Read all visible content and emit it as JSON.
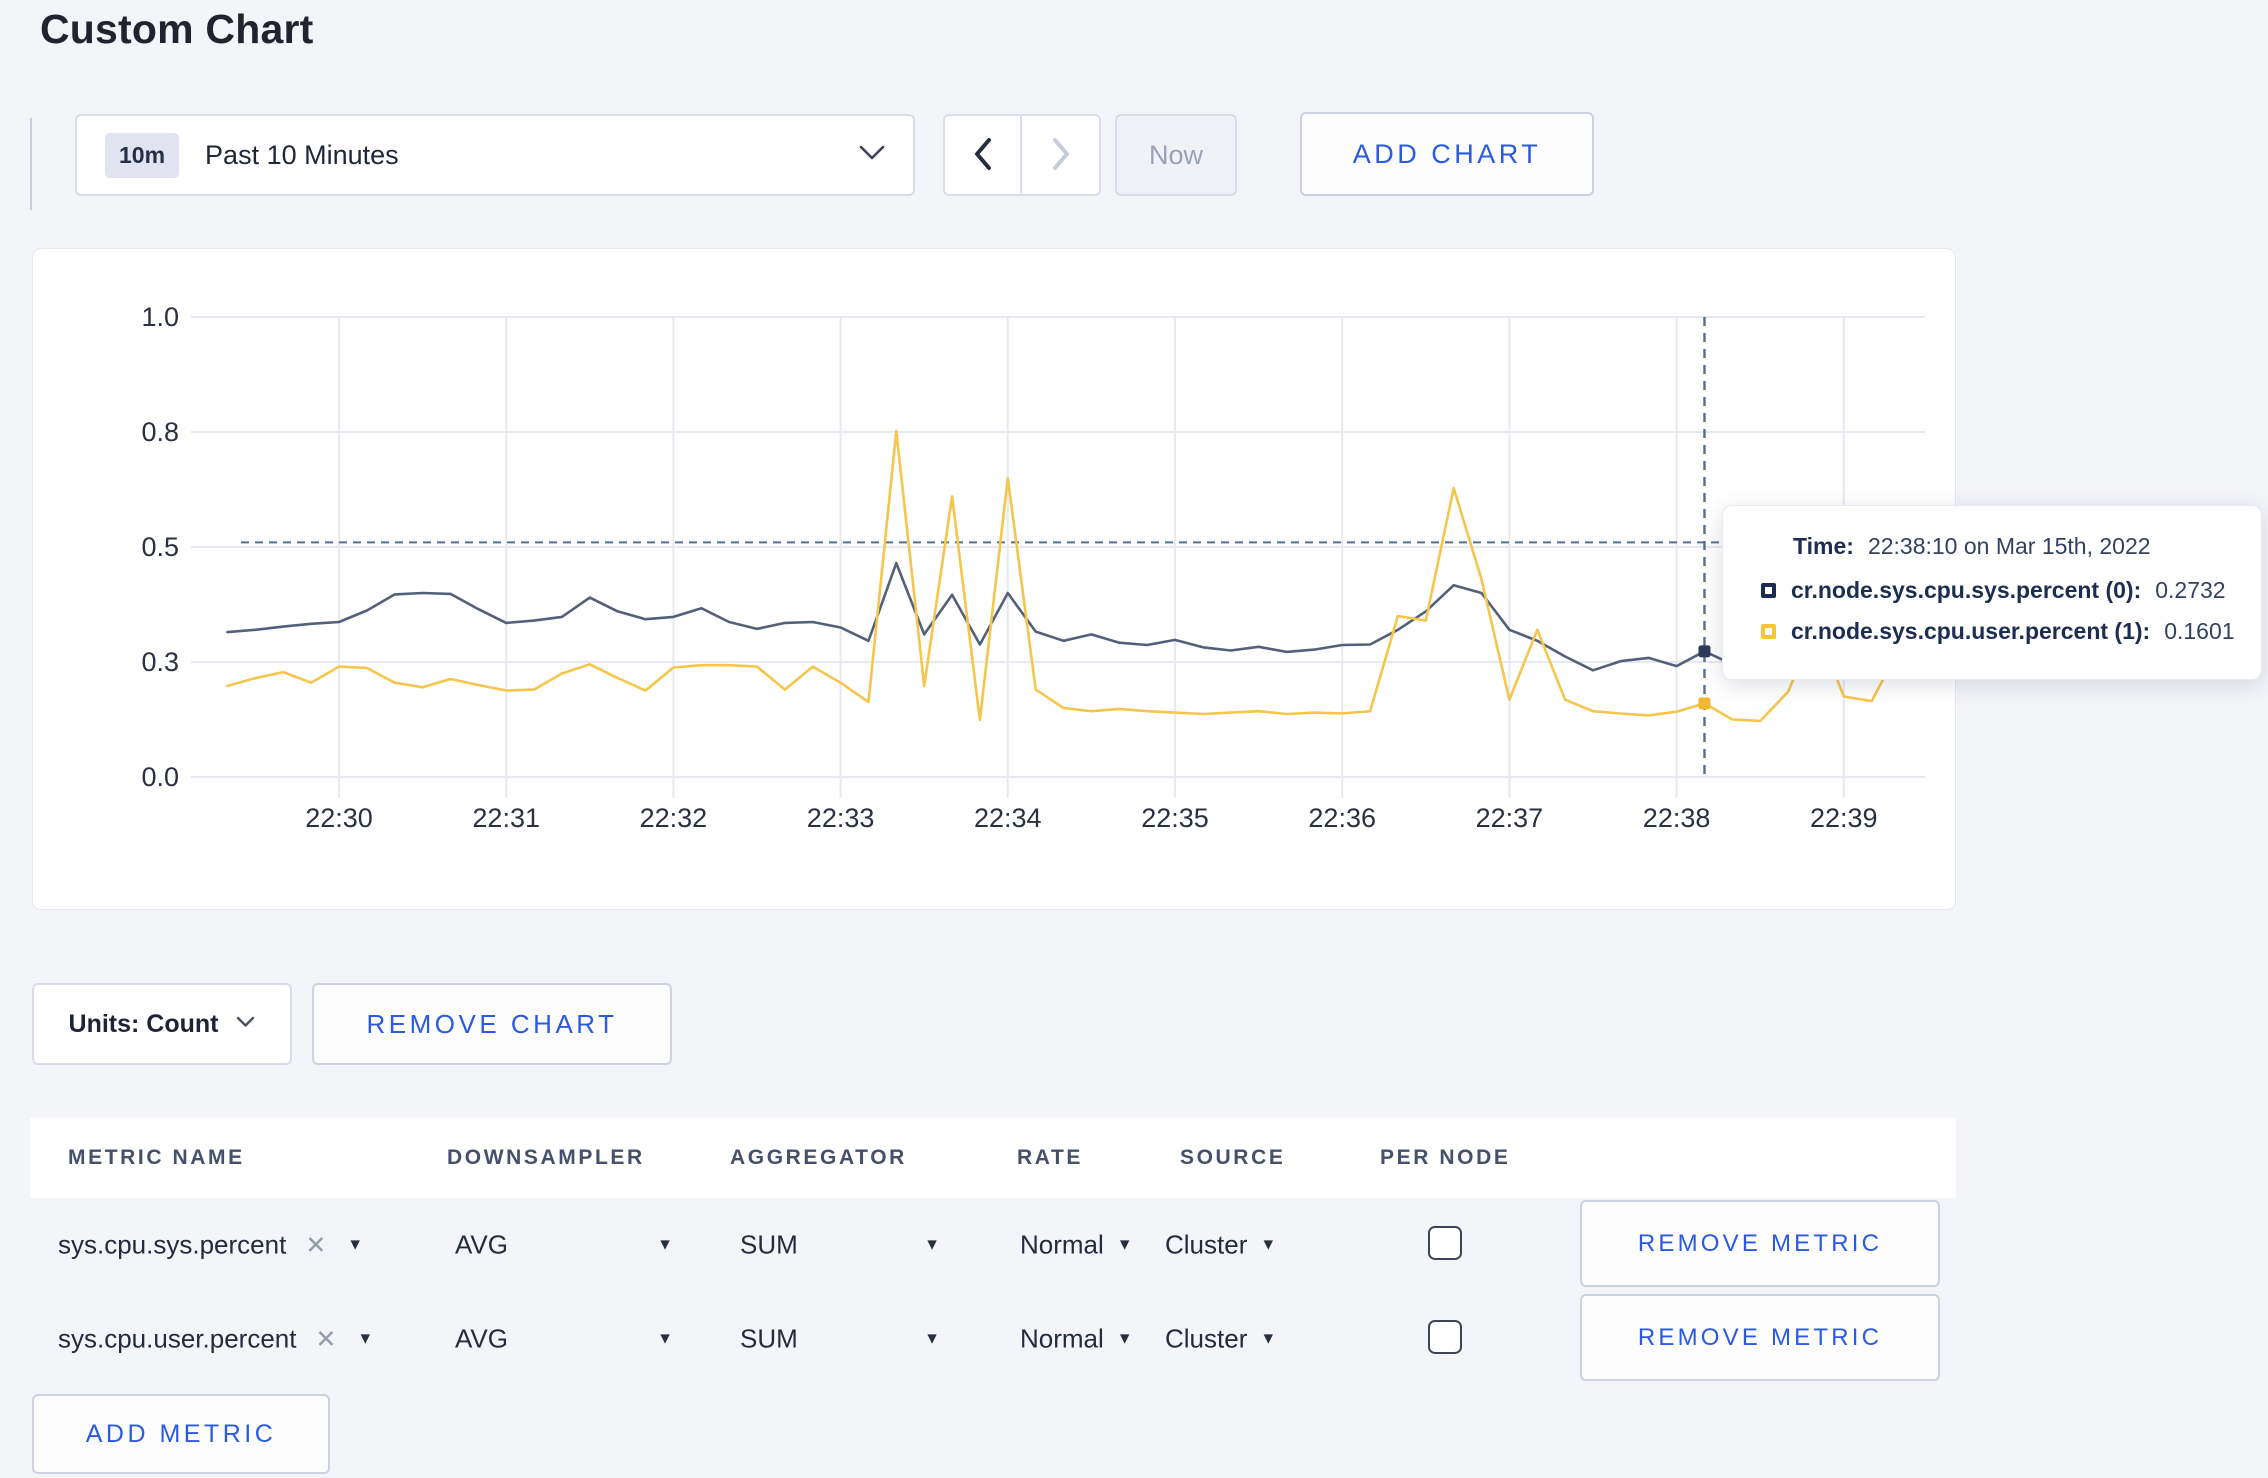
{
  "title": "Custom Chart",
  "toolbar": {
    "range_badge": "10m",
    "range_label": "Past 10 Minutes",
    "now_label": "Now",
    "add_chart_label": "ADD CHART"
  },
  "units_label": "Units: Count",
  "remove_chart_label": "REMOVE CHART",
  "tooltip": {
    "time_label": "Time:",
    "time_value": "22:38:10 on Mar 15th, 2022",
    "rows": [
      {
        "label": "cr.node.sys.cpu.sys.percent (0):",
        "value": "0.2732",
        "color": "#1c2c50"
      },
      {
        "label": "cr.node.sys.cpu.user.percent (1):",
        "value": "0.1601",
        "color": "#fcc43d"
      }
    ]
  },
  "icons": {
    "dropdown": "chevron-down-icon",
    "back": "chevron-left-icon",
    "forward": "chevron-right-icon",
    "remove_tag": "x-icon",
    "select_caret": "caret-down-icon"
  },
  "metrics_table": {
    "headers": [
      "METRIC NAME",
      "DOWNSAMPLER",
      "AGGREGATOR",
      "RATE",
      "SOURCE",
      "PER NODE"
    ],
    "rows": [
      {
        "metric": "sys.cpu.sys.percent",
        "remove_tag": "✕",
        "downsampler": "AVG",
        "aggregator": "SUM",
        "rate": "Normal",
        "source": "Cluster",
        "per_node_checked": false,
        "remove_label": "REMOVE METRIC"
      },
      {
        "metric": "sys.cpu.user.percent",
        "remove_tag": "✕",
        "downsampler": "AVG",
        "aggregator": "SUM",
        "rate": "Normal",
        "source": "Cluster",
        "per_node_checked": false,
        "remove_label": "REMOVE METRIC"
      }
    ],
    "add_metric_label": "ADD METRIC"
  },
  "chart_data": {
    "type": "line",
    "title": "",
    "xlabel": "",
    "ylabel": "",
    "ylim": [
      0,
      1
    ],
    "grid": true,
    "legend_position": "tooltip",
    "x_ticks": [
      "22:30",
      "22:31",
      "22:32",
      "22:33",
      "22:34",
      "22:35",
      "22:36",
      "22:37",
      "22:38",
      "22:39"
    ],
    "y_ticks": [
      {
        "value": 0,
        "label": "0.0"
      },
      {
        "value": 0.25,
        "label": "0.3"
      },
      {
        "value": 0.5,
        "label": "0.5"
      },
      {
        "value": 0.75,
        "label": "0.8"
      },
      {
        "value": 1.0,
        "label": "1.0"
      }
    ],
    "x_start_min": -0.6667,
    "interval_sec": 10,
    "colors": {
      "grid": "#e7e9f0",
      "axis_text": "#2a3040",
      "guide": "#54708f"
    },
    "series": [
      {
        "name": "cr.node.sys.cpu.sys.percent",
        "color": "#545f79",
        "dot_color": "#2e3c59",
        "values": [
          0.315,
          0.32,
          0.327,
          0.333,
          0.337,
          0.362,
          0.397,
          0.4,
          0.398,
          0.365,
          0.335,
          0.34,
          0.348,
          0.39,
          0.36,
          0.343,
          0.348,
          0.367,
          0.337,
          0.322,
          0.335,
          0.337,
          0.325,
          0.296,
          0.465,
          0.31,
          0.396,
          0.288,
          0.4,
          0.316,
          0.296,
          0.31,
          0.292,
          0.287,
          0.298,
          0.282,
          0.275,
          0.283,
          0.272,
          0.277,
          0.287,
          0.288,
          0.32,
          0.36,
          0.417,
          0.4,
          0.32,
          0.296,
          0.262,
          0.232,
          0.252,
          0.259,
          0.241,
          0.2732,
          0.245,
          0.255,
          0.25,
          0.248,
          0.252,
          0.26,
          0.255
        ]
      },
      {
        "name": "cr.node.sys.cpu.user.percent",
        "color": "#f6c54b",
        "dot_color": "#f3b92e",
        "values": [
          0.198,
          0.215,
          0.228,
          0.205,
          0.24,
          0.237,
          0.205,
          0.195,
          0.213,
          0.2,
          0.188,
          0.19,
          0.225,
          0.245,
          0.215,
          0.188,
          0.238,
          0.243,
          0.243,
          0.24,
          0.19,
          0.24,
          0.205,
          0.163,
          0.752,
          0.198,
          0.61,
          0.124,
          0.65,
          0.19,
          0.15,
          0.143,
          0.148,
          0.143,
          0.14,
          0.137,
          0.14,
          0.143,
          0.137,
          0.14,
          0.138,
          0.143,
          0.35,
          0.34,
          0.628,
          0.43,
          0.168,
          0.32,
          0.168,
          0.143,
          0.138,
          0.134,
          0.142,
          0.1601,
          0.125,
          0.122,
          0.185,
          0.33,
          0.175,
          0.165,
          0.28
        ]
      }
    ],
    "hover": {
      "time": "22:38:10",
      "x_minutes": 8.1667,
      "guide_value": 0.51,
      "points": [
        0.2732,
        0.1601
      ]
    }
  }
}
